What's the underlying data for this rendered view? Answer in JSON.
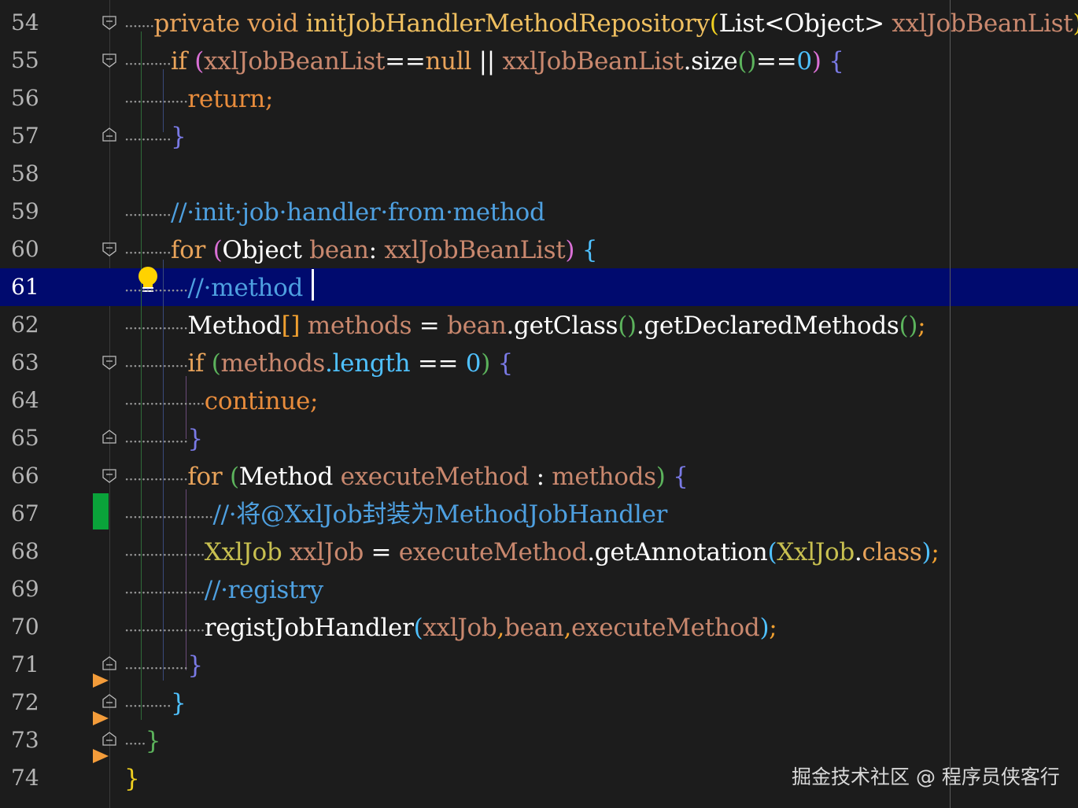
{
  "editor": {
    "current_line": "61",
    "watermark": "掘金技术社区 @ 程序员侠客行",
    "lines": [
      {
        "no": "54"
      },
      {
        "no": "55"
      },
      {
        "no": "56"
      },
      {
        "no": "57"
      },
      {
        "no": "58"
      },
      {
        "no": "59"
      },
      {
        "no": "60"
      },
      {
        "no": "61"
      },
      {
        "no": "62"
      },
      {
        "no": "63"
      },
      {
        "no": "64"
      },
      {
        "no": "65"
      },
      {
        "no": "66"
      },
      {
        "no": "67"
      },
      {
        "no": "68"
      },
      {
        "no": "69"
      },
      {
        "no": "70"
      },
      {
        "no": "71"
      },
      {
        "no": "72"
      },
      {
        "no": "73"
      },
      {
        "no": "74"
      }
    ]
  },
  "code": {
    "l54": {
      "private": "private",
      "void": "void",
      "name": "initJobHandlerMethodRepository",
      "p1": "(",
      "type": "List<Object>",
      "param": "xxlJobBeanList",
      "p2": ")",
      "brace": "{"
    },
    "l55": {
      "if": "if",
      "p1": "(",
      "a": "xxlJobBeanList",
      "op1": "==",
      "null": "null",
      "or": "||",
      "b": "xxlJobBeanList",
      "size": ".size",
      "p2": "()",
      "op2": "==",
      "zero": "0",
      "p3": ")",
      "brace": "{"
    },
    "l56": {
      "ret": "return;"
    },
    "l57": {
      "brace": "}"
    },
    "l59": {
      "comment": "//·init·job·handler·from·method"
    },
    "l60": {
      "for": "for",
      "p1": "(",
      "type": "Object",
      "var": "bean",
      "colon": ":",
      "list": "xxlJobBeanList",
      "p2": ")",
      "brace": "{"
    },
    "l61": {
      "comment": "//·method"
    },
    "l62": {
      "type": "Method",
      "arr": "[]",
      "var": "methods",
      "eq": "=",
      "bean": "bean",
      "call1": ".getClass",
      "p1": "()",
      "call2": ".getDeclaredMethods",
      "p2": "()",
      "semi": ";"
    },
    "l63": {
      "if": "if",
      "p1": "(",
      "var": "methods",
      "len": ".length",
      "op": "==",
      "zero": "0",
      "p2": ")",
      "brace": "{"
    },
    "l64": {
      "cont": "continue;"
    },
    "l65": {
      "brace": "}"
    },
    "l66": {
      "for": "for",
      "p1": "(",
      "type": "Method",
      "var": "executeMethod",
      "colon": ":",
      "list": "methods",
      "p2": ")",
      "brace": "{"
    },
    "l67": {
      "comment": "//·将@XxlJob封装为MethodJobHandler"
    },
    "l68": {
      "type": "XxlJob",
      "var": "xxlJob",
      "eq": "=",
      "obj": "executeMethod",
      "call": ".getAnnotation",
      "p1": "(",
      "cls": "XxlJob",
      "dot": ".",
      "clskw": "class",
      "p2": ")",
      "semi": ";"
    },
    "l69": {
      "comment": "//·registry"
    },
    "l70": {
      "call": "registJobHandler",
      "p1": "(",
      "a": "xxlJob",
      "c1": ",",
      "b": "bean",
      "c2": ",",
      "c": "executeMethod",
      "p2": ")",
      "semi": ";"
    },
    "l71": {
      "brace": "}"
    },
    "l72": {
      "brace": "}"
    },
    "l73": {
      "brace": "}"
    },
    "l74": {
      "brace": "}"
    }
  },
  "colors": {
    "background": "#1c1c1c",
    "current_line": "#000a6e",
    "comment": "#4ea0e0",
    "keyword": "#e8a35a"
  },
  "icons": [
    "fold-icon",
    "lightbulb-icon",
    "breakpoint-arrow-icon",
    "change-marker"
  ]
}
